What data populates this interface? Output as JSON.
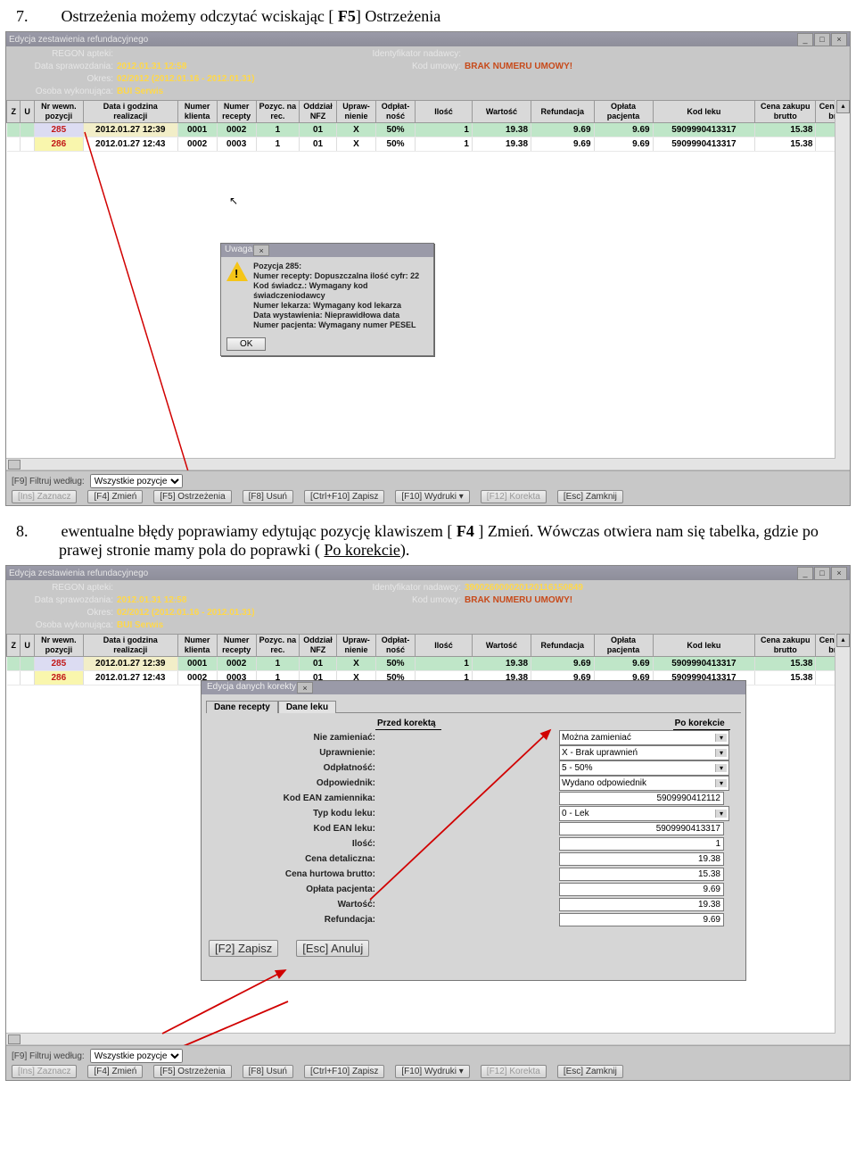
{
  "instr7_num": "7.",
  "instr7_a": "Ostrzeżenia możemy odczytać wciskając [",
  "instr7_b": " F5",
  "instr7_c": "] Ostrzeżenia",
  "instr8_num": "8.",
  "instr8_a": "ewentualne błędy poprawiamy edytując pozycję klawiszem  [",
  "instr8_b": " F4 ",
  "instr8_c": "] Zmień",
  "instr8_d": ". Wówczas otwiera nam się tabelka, gdzie po prawej stronie mamy pola do poprawki ( ",
  "instr8_e": "Po korekcie",
  "instr8_f": ").",
  "app_title": "Edycja zestawienia refundacyjnego",
  "meta": {
    "regon_l": "REGON apteki:",
    "data_l": "Data sprawozdania:",
    "data_v": "2012.01.31 12:58",
    "okres_l": "Okres:",
    "okres_v": "02/2012 (2012.01.16 - 2012.01.31)",
    "osoba_l": "Osoba wykonująca:",
    "osoba_v": "BUI Serwis",
    "ident_l": "Identyfikator nadawcy:",
    "ident_v2": "390026000020120116150849",
    "umowa_l": "Kod umowy:",
    "umowa_v": "BRAK NUMERU UMOWY!"
  },
  "headers": [
    "Z",
    "U",
    "Nr wewn. pozycji",
    "Data i godzina realizacji",
    "Numer klienta",
    "Numer recepty",
    "Pozyc. na rec.",
    "Oddział NFZ",
    "Upraw- nienie",
    "Odpłat- ność",
    "Ilość",
    "Wartość",
    "Refundacja",
    "Opłata pacjenta",
    "Kod leku",
    "Cena zakupu brutto",
    "Cena d br"
  ],
  "rows": [
    {
      "nr": "285",
      "dt": "2012.01.27 12:39",
      "k": "0001",
      "r": "0002",
      "p": "1",
      "o": "01",
      "u": "X",
      "od": "50%",
      "il": "1",
      "w": "19.38",
      "rf": "9.69",
      "op": "9.69",
      "kod": "5909990413317",
      "cz": "15.38"
    },
    {
      "nr": "286",
      "dt": "2012.01.27 12:43",
      "k": "0002",
      "r": "0003",
      "p": "1",
      "o": "01",
      "u": "X",
      "od": "50%",
      "il": "1",
      "w": "19.38",
      "rf": "9.69",
      "op": "9.69",
      "kod": "5909990413317",
      "cz": "15.38"
    }
  ],
  "filter_l": "[F9] Filtruj według:",
  "filter_v": "Wszystkie pozycje",
  "btns": {
    "zaz": "[Ins] Zaznacz",
    "zm": "[F4] Zmień",
    "ost": "[F5] Ostrzeżenia",
    "us": "[F8] Usuń",
    "zap": "[Ctrl+F10] Zapisz",
    "wyd": "[F10] Wydruki ▾",
    "kor": "[F12] Korekta",
    "zam": "[Esc] Zamknij"
  },
  "warn": {
    "title": "Uwaga",
    "l1": "Pozycja 285:",
    "l2": "Numer recepty: Dopuszczalna ilość cyfr: 22",
    "l3": "Kod świadcz.: Wymagany kod świadczeniodawcy",
    "l4": "Numer lekarza: Wymagany kod lekarza",
    "l5": "Data wystawienia: Nieprawidłowa data",
    "l6": "Numer pacjenta: Wymagany numer PESEL",
    "ok": "OK"
  },
  "dlg2": {
    "title": "Edycja danych korekty",
    "tab1": "Dane recepty",
    "tab2": "Dane leku",
    "h1": "Przed korektą",
    "h2": "Po korekcie",
    "labs": [
      "Nie zamieniać:",
      "Uprawnienie:",
      "Odpłatność:",
      "Odpowiednik:",
      "Kod EAN zamiennika:",
      "Typ kodu leku:",
      "Kod EAN leku:",
      "Ilość:",
      "Cena detaliczna:",
      "Cena hurtowa brutto:",
      "Opłata pacjenta:",
      "Wartość:",
      "Refundacja:"
    ],
    "vals": [
      "Można zamieniać",
      "X - Brak uprawnień",
      "5 - 50%",
      "Wydano odpowiednik",
      "5909990412112",
      "0 - Lek",
      "5909990413317",
      "1",
      "19.38",
      "15.38",
      "9.69",
      "19.38",
      "9.69"
    ],
    "bzap": "[F2] Zapisz",
    "ban": "[Esc] Anuluj"
  }
}
